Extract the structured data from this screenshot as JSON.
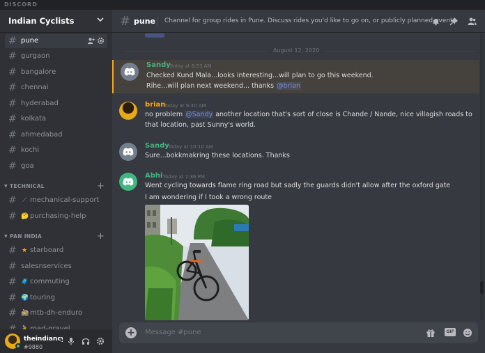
{
  "titlebar": {
    "wordmark": "DISCORD"
  },
  "server": {
    "name": "Indian Cyclists"
  },
  "channels": [
    {
      "name": "pune",
      "active": true
    },
    {
      "name": "gurgaon"
    },
    {
      "name": "bangalore"
    },
    {
      "name": "chennai"
    },
    {
      "name": "hyderabad"
    },
    {
      "name": "kolkata"
    },
    {
      "name": "ahmedabad"
    },
    {
      "name": "kochi"
    },
    {
      "name": "goa"
    }
  ],
  "categories": {
    "technical": {
      "label": "TECHNICAL",
      "channels": [
        {
          "emoji": "⟋",
          "name": "mechanical-support"
        },
        {
          "emoji": "🤔",
          "name": "purchasing-help"
        }
      ]
    },
    "pan_india": {
      "label": "PAN INDIA",
      "channels": [
        {
          "emoji": "★",
          "name": "starboard"
        },
        {
          "emoji": "",
          "name": "salesnservices"
        },
        {
          "emoji": "🧳",
          "name": "commuting"
        },
        {
          "emoji": "🌍",
          "name": "touring"
        },
        {
          "emoji": "🚵",
          "name": "mtb-dh-enduro"
        },
        {
          "emoji": "🚴",
          "name": "road-gravel"
        }
      ]
    }
  },
  "user": {
    "name": "theindiancy...",
    "tag": "#9880"
  },
  "channel_header": {
    "name": "pune",
    "topic": "Channel for group rides in Pune. Discuss rides you'd like to go on, or publicly planned events."
  },
  "date_divider": "August 12, 2020",
  "messages": [
    {
      "author": "Sandy",
      "color": "#43b581",
      "time": "Today at 6:53 AM",
      "lines": [
        "Checked Kund Mala...looks interesting...will plan to go this weekend."
      ],
      "line2_prefix": "Rihe...will plan next weekend... thanks ",
      "line2_mention": "@brian"
    },
    {
      "author": "brian",
      "color": "#faa61a",
      "time": "Today at 9:40 AM",
      "line1_prefix": "no problem ",
      "line1_mention": "@Sandy",
      "line1_suffix": " another location that's sort of close is Chande / Nande, nice villagish roads to",
      "line2": "that location, past Sunny's world."
    },
    {
      "author": "Sandy",
      "color": "#43b581",
      "time": "Today at 10:10 AM",
      "line1": "Sure...bokkmakring these locations. Thanks"
    },
    {
      "author": "Abhi",
      "color": "#43b581",
      "time": "Today at 1:36 PM",
      "line1": "Went cycling towards flame ring road but sadly the guards didn't allow after the oxford gate",
      "line2": "I am wondering if I took a wrong route"
    }
  ],
  "composer": {
    "placeholder": "Message #pune",
    "gif_label": "GIF"
  }
}
